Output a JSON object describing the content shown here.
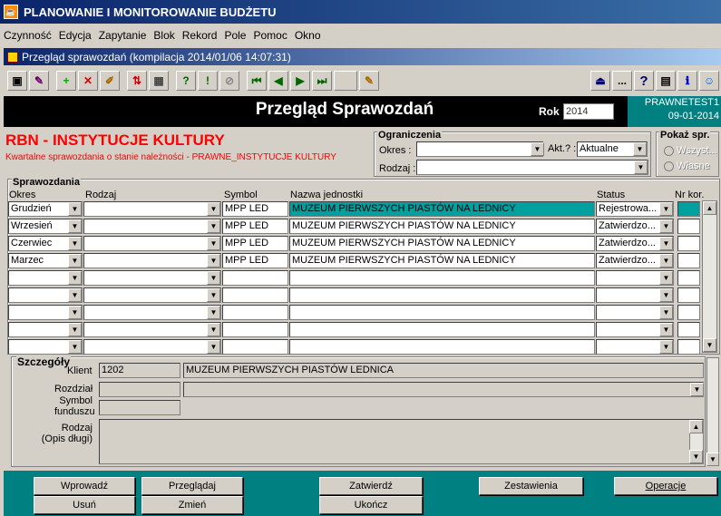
{
  "app": {
    "title": "PLANOWANIE I MONITOROWANIE BUDŻETU"
  },
  "menu": [
    "Czynność",
    "Edycja",
    "Zapytanie",
    "Blok",
    "Rekord",
    "Pole",
    "Pomoc",
    "Okno"
  ],
  "window": {
    "title": "Przegląd sprawozdań (kompilacja 2014/01/06 14:07:31)"
  },
  "toolbar": {
    "icons": [
      "save-icon",
      "print-icon",
      "add-record-icon",
      "delete-record-icon",
      "edit-icon",
      "split-icon",
      "grid-icon",
      "query-icon",
      "query-run-icon",
      "query-cancel-icon",
      "first-record-icon",
      "prev-record-icon",
      "next-record-icon",
      "last-record-icon",
      "blank-icon",
      "calc-icon"
    ],
    "right_icons": [
      "exit-icon",
      "more-icon",
      "help-icon",
      "calculator-icon",
      "info-icon",
      "user-icon"
    ],
    "more_label": "...",
    "help_label": "?"
  },
  "header": {
    "title": "Przegląd Sprawozdań",
    "rok_label": "Rok",
    "rok_value": "2014",
    "env_name": "PRAWNETEST1",
    "env_date": "09-01-2014"
  },
  "report": {
    "title": "RBN - INSTYTUCJE KULTURY",
    "subtitle": "Kwartalne sprawozdania o stanie należności - PRAWNE_INSTYTUCJE KULTURY"
  },
  "ograniczenia": {
    "title": "Ograniczenia",
    "okres_label": "Okres :",
    "okres_value": "",
    "akt_label": "Akt.? :",
    "akt_value": "Aktualne",
    "rodzaj_label": "Rodzaj :",
    "rodzaj_value": ""
  },
  "pokaz": {
    "title": "Pokaż spr.",
    "opt1": "Wszyst...",
    "opt2": "Własne"
  },
  "sprawozdania": {
    "title": "Sprawozdania",
    "headers": {
      "okres": "Okres",
      "rodzaj": "Rodzaj",
      "symbol": "Symbol",
      "nazwa": "Nazwa jednostki",
      "status": "Status",
      "nr_kor": "Nr kor."
    },
    "rows": [
      {
        "okres": "Grudzień",
        "rodzaj": "",
        "symbol": "MPP LED",
        "nazwa": "MUZEUM PIERWSZYCH PIASTÓW NA LEDNICY",
        "status": "Rejestrowa...",
        "nr_kor": ""
      },
      {
        "okres": "Wrzesień",
        "rodzaj": "",
        "symbol": "MPP LED",
        "nazwa": "MUZEUM PIERWSZYCH PIASTÓW NA LEDNICY",
        "status": "Zatwierdzo...",
        "nr_kor": ""
      },
      {
        "okres": "Czerwiec",
        "rodzaj": "",
        "symbol": "MPP LED",
        "nazwa": "MUZEUM PIERWSZYCH PIASTÓW NA LEDNICY",
        "status": "Zatwierdzo...",
        "nr_kor": ""
      },
      {
        "okres": "Marzec",
        "rodzaj": "",
        "symbol": "MPP LED",
        "nazwa": "MUZEUM PIERWSZYCH PIASTÓW NA LEDNICY",
        "status": "Zatwierdzo...",
        "nr_kor": ""
      },
      {
        "okres": "",
        "rodzaj": "",
        "symbol": "",
        "nazwa": "",
        "status": "",
        "nr_kor": ""
      },
      {
        "okres": "",
        "rodzaj": "",
        "symbol": "",
        "nazwa": "",
        "status": "",
        "nr_kor": ""
      },
      {
        "okres": "",
        "rodzaj": "",
        "symbol": "",
        "nazwa": "",
        "status": "",
        "nr_kor": ""
      },
      {
        "okres": "",
        "rodzaj": "",
        "symbol": "",
        "nazwa": "",
        "status": "",
        "nr_kor": ""
      },
      {
        "okres": "",
        "rodzaj": "",
        "symbol": "",
        "nazwa": "",
        "status": "",
        "nr_kor": ""
      }
    ]
  },
  "szczegoly": {
    "title": "Szczegóły",
    "klient_label": "Klient",
    "klient_id": "1202",
    "klient_name": "MUZEUM PIERWSZYCH PIASTÓW LEDNICA",
    "rozdzial_label": "Rozdział",
    "symbol_label": "Symbol funduszu",
    "rodzaj_label": "Rodzaj (Opis długi)"
  },
  "buttons": {
    "wprowadz": "Wprowadź",
    "przegladaj": "Przeglądaj",
    "zatwierdz": "Zatwierdź",
    "zestawienia": "Zestawienia",
    "operacje": "Operacje",
    "usun": "Usuń",
    "zmien": "Zmień",
    "ukoncz": "Ukończ"
  },
  "colors": {
    "accent_teal": "#008080",
    "title_red": "#ff0000",
    "header_black": "#000000",
    "row_current": "#00a0a0"
  }
}
